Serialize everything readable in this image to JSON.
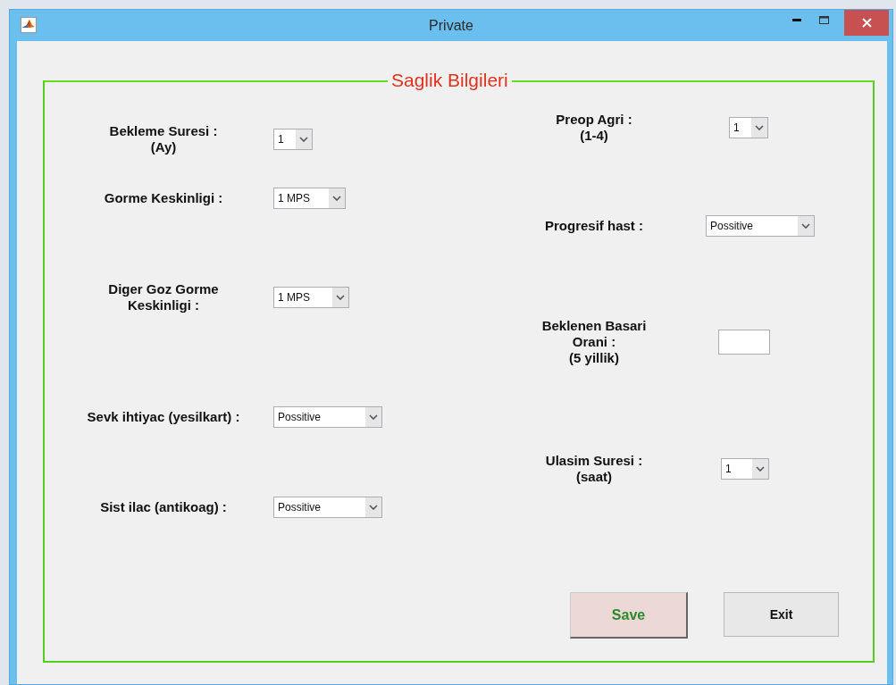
{
  "window": {
    "title": "Private"
  },
  "panel": {
    "title": "Saglik Bilgileri"
  },
  "left_fields": [
    {
      "label": "Bekleme Suresi :\n(Ay)",
      "kind": "select",
      "value": "1"
    },
    {
      "label": "Gorme Keskinligi :",
      "kind": "select",
      "value": "1 MPS"
    },
    {
      "label": "Diger Goz Gorme\nKeskinligi :",
      "kind": "select",
      "value": "1 MPS"
    },
    {
      "label": "Sevk ihtiyac (yesilkart) :",
      "kind": "select",
      "value": "Possitive"
    },
    {
      "label": "Sist ilac (antikoag) :",
      "kind": "select",
      "value": "Possitive"
    }
  ],
  "right_fields": [
    {
      "label": "Preop Agri :\n(1-4)",
      "kind": "select",
      "value": "1"
    },
    {
      "label": "Progresif hast :",
      "kind": "select",
      "value": "Possitive"
    },
    {
      "label": "Beklenen Basari\nOrani :\n(5 yillik)",
      "kind": "text"
    },
    {
      "label": "Ulasim Suresi :\n(saat)",
      "kind": "select",
      "value": "1"
    }
  ],
  "buttons": [
    {
      "label": "Save",
      "kind": "primary"
    },
    {
      "label": "Exit",
      "kind": "normal"
    }
  ]
}
